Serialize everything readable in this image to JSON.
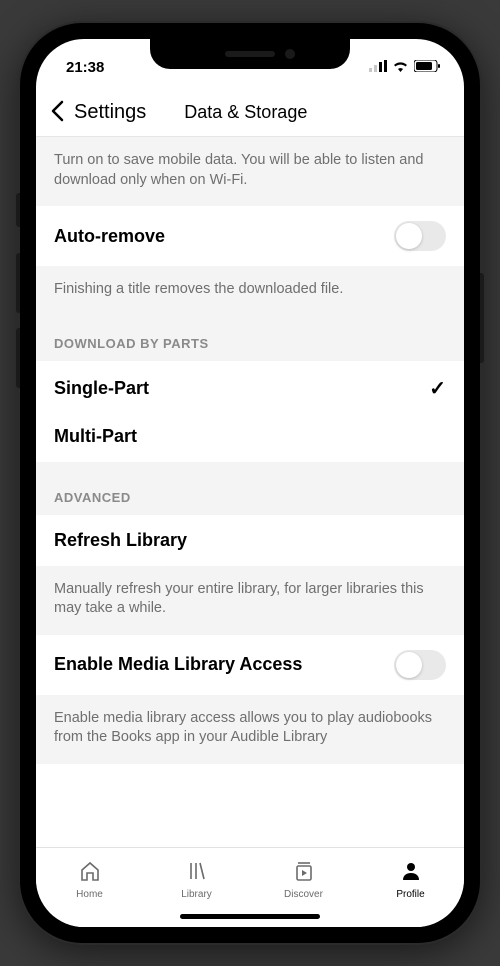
{
  "status": {
    "time": "21:38"
  },
  "nav": {
    "back": "Settings",
    "title": "Data & Storage"
  },
  "sections": {
    "wifi_desc": "Turn on to save mobile data. You will be able to listen and download only when on Wi-Fi.",
    "auto_remove": {
      "label": "Auto-remove",
      "desc": "Finishing a title removes the downloaded file."
    },
    "download_parts": {
      "header": "DOWNLOAD BY PARTS",
      "single": "Single-Part",
      "multi": "Multi-Part"
    },
    "advanced": {
      "header": "ADVANCED",
      "refresh": {
        "label": "Refresh Library",
        "desc": "Manually refresh your entire library, for larger libraries this may take a while."
      },
      "media_access": {
        "label": "Enable Media Library Access",
        "desc": "Enable media library access allows you to play audiobooks from the Books app in your Audible Library"
      }
    }
  },
  "tabs": {
    "home": "Home",
    "library": "Library",
    "discover": "Discover",
    "profile": "Profile"
  }
}
